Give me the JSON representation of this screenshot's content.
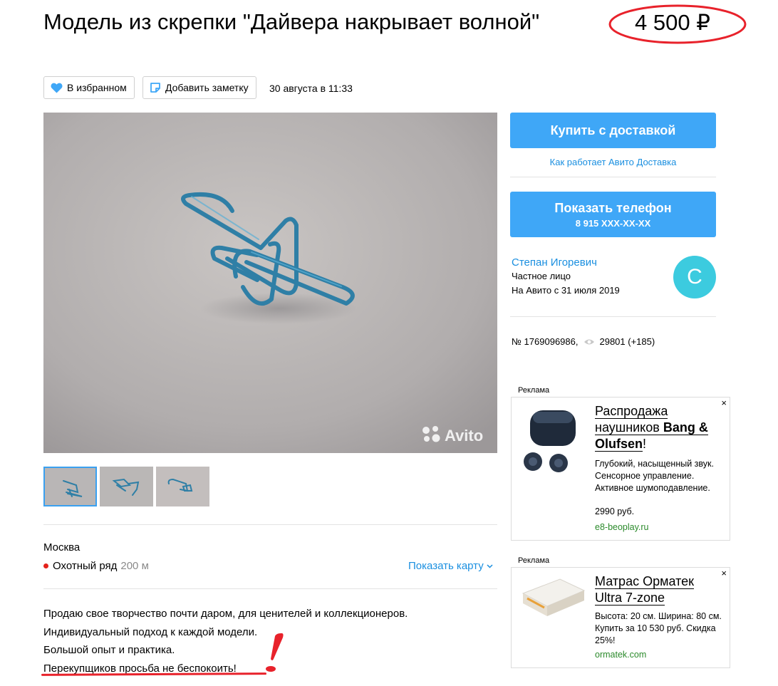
{
  "listing": {
    "title": "Модель из скрепки \"Дайвера накрывает волной\"",
    "price": "4 500 ₽",
    "favorite_label": "В избранном",
    "note_label": "Добавить заметку",
    "date": "30 августа в 11:33",
    "photo_watermark": "Avito"
  },
  "actions": {
    "buy_label": "Купить с доставкой",
    "delivery_link": "Как работает Авито Доставка",
    "phone_label": "Показать телефон",
    "phone_number": "8 915 XXX-XX-XX"
  },
  "seller": {
    "name": "Степан Игоревич",
    "type": "Частное лицо",
    "since": "На Авито с 31 июля 2019",
    "avatar_letter": "С"
  },
  "meta": {
    "number": "№ 1769096986,",
    "views": "29801 (+185)"
  },
  "location": {
    "city": "Москва",
    "metro": "Охотный ряд",
    "distance": "200 м",
    "map_link": "Показать карту"
  },
  "description": [
    "Продаю свое творчество почти даром, для ценителей и коллекционеров.",
    "Индивидуальный подход к каждой модели.",
    "Большой опыт и практика.",
    "Перекупщиков просьба не беспокоить!"
  ],
  "ads": [
    {
      "label": "Реклама",
      "close": "×",
      "head_plain_1": "Распродажа наушников ",
      "head_bold": "Bang & Olufsen",
      "head_plain_2": "!",
      "text": "Глубокий, насыщенный звук. Сенсорное управление. Активное шумоподавление.",
      "price": "2990 руб.",
      "domain": "e8-beoplay.ru"
    },
    {
      "label": "Реклама",
      "close": "×",
      "head": "Матрас Орматек Ultra 7-zone",
      "text": "Высота: 20 см. Ширина: 80 см. Купить за 10 530 руб. Скидка 25%!",
      "domain": "ormatek.com"
    }
  ],
  "colors": {
    "accent_blue": "#3fa7f7",
    "link_blue": "#1a8fe0",
    "avatar": "#3ccbdf",
    "annotation_red": "#e8222b",
    "ad_domain_green": "#2b8a2b"
  },
  "icons": {
    "favorite": "heart-icon",
    "note": "note-icon",
    "views": "eye-icon",
    "metro": "metro-dot-icon",
    "map": "chevron-down-icon",
    "close": "close-icon"
  }
}
